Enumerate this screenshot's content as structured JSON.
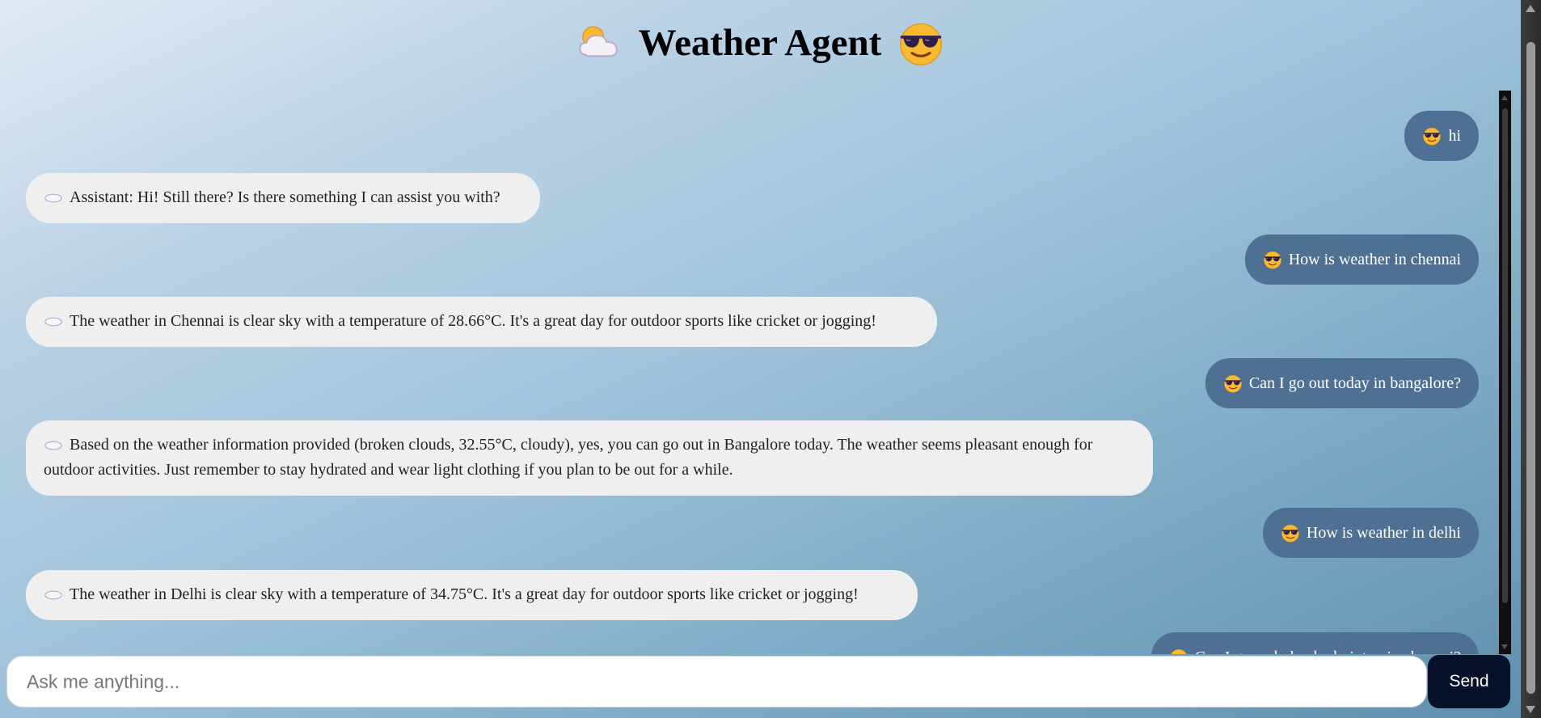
{
  "header": {
    "title": "Weather Agent",
    "left_icon": "sun-behind-cloud-icon",
    "right_icon": "sunglasses-face-icon"
  },
  "messages": [
    {
      "role": "user",
      "icon": "sunglasses-face-icon",
      "text": "hi"
    },
    {
      "role": "assistant",
      "icon": "cloud-icon",
      "text": "Assistant: Hi! Still there? Is there something I can assist you with?"
    },
    {
      "role": "user",
      "icon": "sunglasses-face-icon",
      "text": "How is weather in chennai"
    },
    {
      "role": "assistant",
      "icon": "cloud-icon",
      "text": "The weather in Chennai is clear sky with a temperature of 28.66°C. It's a great day for outdoor sports like cricket or jogging!"
    },
    {
      "role": "user",
      "icon": "sunglasses-face-icon",
      "text": "Can I go out today in bangalore?"
    },
    {
      "role": "assistant",
      "icon": "cloud-icon",
      "text": "Based on the weather information provided (broken clouds, 32.55°C, cloudy), yes, you can go out in Bangalore today. The weather seems pleasant enough for outdoor activities. Just remember to stay hydrated and wear light clothing if you plan to be out for a while."
    },
    {
      "role": "user",
      "icon": "sunglasses-face-icon",
      "text": "How is weather in delhi"
    },
    {
      "role": "assistant",
      "icon": "cloud-icon",
      "text": "The weather in Delhi is clear sky with a temperature of 34.75°C. It's a great day for outdoor sports like cricket or jogging!"
    },
    {
      "role": "user",
      "icon": "sunglasses-face-icon",
      "text": "Can I go and play badminton in chennai?"
    }
  ],
  "input": {
    "placeholder": "Ask me anything...",
    "value": ""
  },
  "send_label": "Send",
  "colors": {
    "user_bubble": "#4e7193",
    "assistant_bubble": "#efefef",
    "send_button": "#06112a"
  }
}
